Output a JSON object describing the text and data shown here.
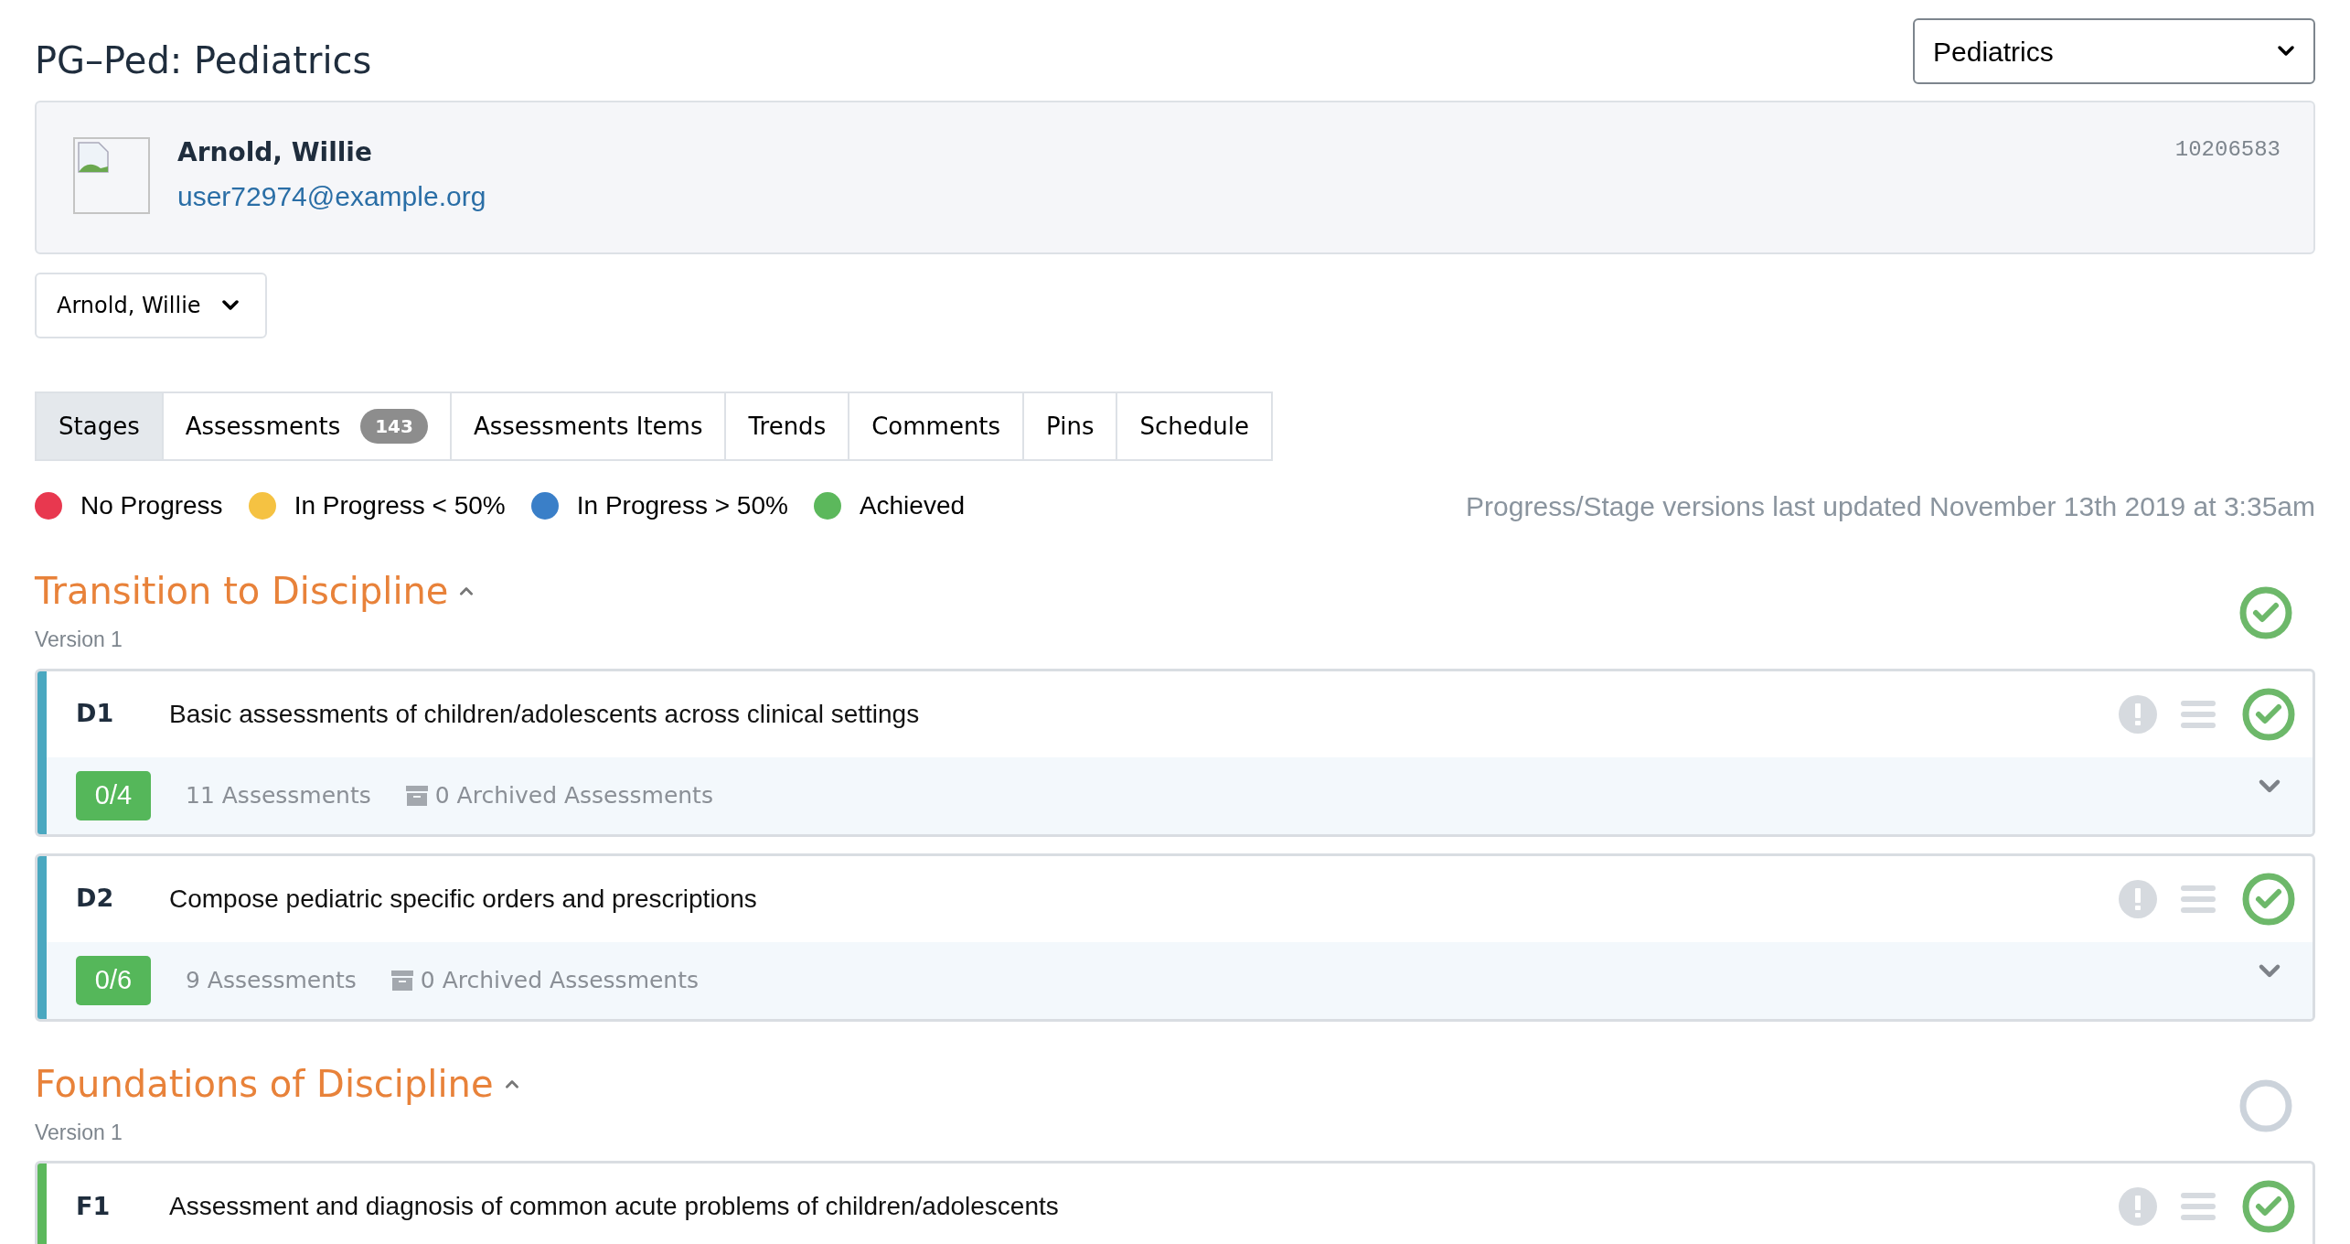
{
  "header": {
    "title": "PG–Ped: Pediatrics",
    "program_select": "Pediatrics"
  },
  "profile": {
    "name": "Arnold, Willie",
    "email": "user72974@example.org",
    "id": "10206583"
  },
  "learner_select": "Arnold, Willie",
  "tabs": [
    {
      "label": "Stages",
      "selected": true
    },
    {
      "label": "Assessments",
      "badge": "143",
      "selected": false
    },
    {
      "label": "Assessments Items",
      "selected": false
    },
    {
      "label": "Trends",
      "selected": false
    },
    {
      "label": "Comments",
      "selected": false
    },
    {
      "label": "Pins",
      "selected": false
    },
    {
      "label": "Schedule",
      "selected": false
    }
  ],
  "legend": [
    {
      "label": "No Progress",
      "color": "#e8384f"
    },
    {
      "label": "In Progress < 50%",
      "color": "#f5c242"
    },
    {
      "label": "In Progress > 50%",
      "color": "#3a7fc8"
    },
    {
      "label": "Achieved",
      "color": "#5cb85c"
    }
  ],
  "last_updated": "Progress/Stage versions last updated November 13th 2019 at 3:35am",
  "stages": [
    {
      "title": "Transition to Discipline",
      "expanded": true,
      "version": "Version 1",
      "achieved": true,
      "competencies": [
        {
          "code": "D1",
          "description": "Basic assessments of children/adolescents across clinical settings",
          "progress": "0/4",
          "assessments": "11 Assessments",
          "archived": "0 Archived Assessments",
          "achieved": true,
          "expanded": false,
          "color": "#4aa8c0"
        },
        {
          "code": "D2",
          "description": "Compose pediatric specific orders and prescriptions",
          "progress": "0/6",
          "assessments": "9 Assessments",
          "archived": "0 Archived Assessments",
          "achieved": true,
          "expanded": false,
          "color": "#4aa8c0"
        }
      ]
    },
    {
      "title": "Foundations of Discipline",
      "expanded": true,
      "version": "Version 1",
      "achieved": false,
      "competencies": [
        {
          "code": "F1",
          "description": "Assessment and diagnosis of common acute problems of children/adolescents",
          "achieved": true,
          "color": "#5cb85c"
        }
      ]
    }
  ]
}
